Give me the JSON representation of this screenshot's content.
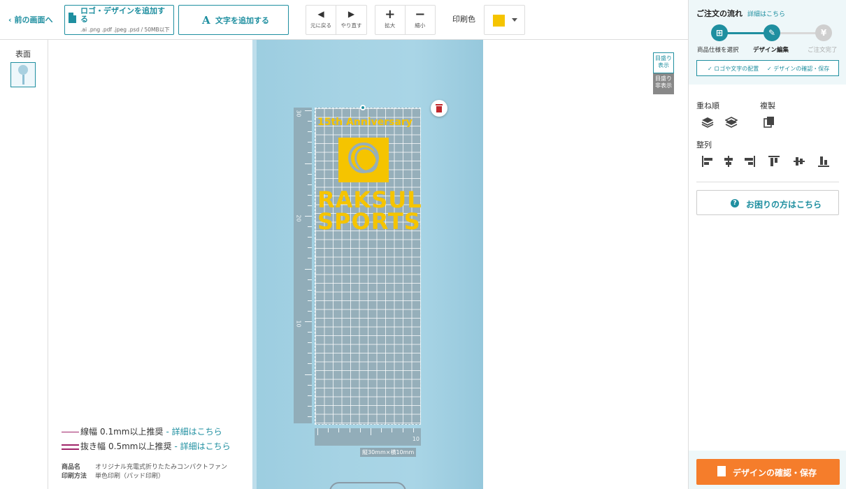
{
  "toolbar": {
    "back_label": "前の画面へ",
    "logo_button": {
      "label": "ロゴ・デザインを追加する",
      "formats": ".ai .png .pdf .jpeg .psd / 50MB以下"
    },
    "text_button": {
      "icon": "A",
      "label": "文字を追加する"
    },
    "undo_label": "元に戻る",
    "redo_label": "やり直す",
    "zoom_in_label": "拡大",
    "zoom_out_label": "縮小",
    "print_color_label": "印刷色",
    "print_color": "#f5c400"
  },
  "pages": {
    "label": "表面"
  },
  "canvas": {
    "guide_on_label": "目盛り表示",
    "guide_off_label": "目盛り非表示",
    "ruler_marks": [
      "30",
      "20",
      "10"
    ],
    "ruler_bottom_mark": "10",
    "dimension_label": "縦30mm×横10mm",
    "design_text_top": "15th Anniversary",
    "design_text_brand_1": "RAKSUL",
    "design_text_brand_2": "SPORTS",
    "design_color": "#f5c400"
  },
  "notes": {
    "line_width": {
      "label": "線幅",
      "value": "0.1mm以上推奨",
      "link": "- 詳細はこちら"
    },
    "cutout_width": {
      "label": "抜き幅",
      "value": "0.5mm以上推奨",
      "link": "- 詳細はこちら"
    },
    "product_key": "商品名",
    "product_value": "オリジナル充電式折りたたみコンパクトファン",
    "method_key": "印刷方法",
    "method_value": "単色印刷（パッド印刷）"
  },
  "panel": {
    "flow_title": "ご注文の流れ",
    "flow_detail_link": "詳細はこちら",
    "steps": [
      {
        "label": "商品仕様を選択",
        "icon": "gift-icon"
      },
      {
        "label": "デザイン編集",
        "icon": "pencil-icon"
      },
      {
        "label": "ご注文完了",
        "icon": "yen-icon"
      }
    ],
    "substeps": [
      "✓ ロゴや文字の配置",
      "✓ デザインの確認・保存"
    ],
    "layer_label": "重ね順",
    "duplicate_label": "複製",
    "align_label": "整列",
    "help_label": "お困りの方はこちら",
    "cta_label": "デザインの確認・保存",
    "colors": {
      "accent": "#1f8fa0",
      "cta": "#f57d2b",
      "inactive": "#cfcfcf"
    }
  }
}
